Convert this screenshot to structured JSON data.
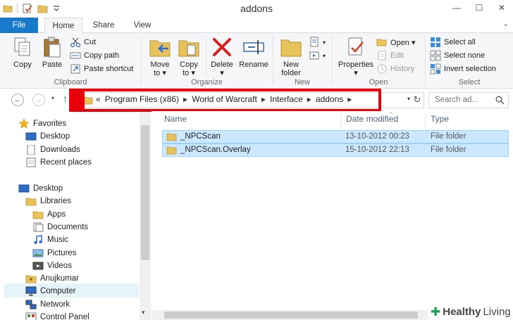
{
  "window": {
    "title": "addons",
    "minimize": "—",
    "maximize": "☐",
    "close": "✕"
  },
  "ribbon_tabs": {
    "file": "File",
    "home": "Home",
    "share": "Share",
    "view": "View",
    "expand": "⌄"
  },
  "ribbon": {
    "clipboard": {
      "label": "Clipboard",
      "copy": "Copy",
      "paste": "Paste",
      "cut": "Cut",
      "copy_path": "Copy path",
      "paste_shortcut": "Paste shortcut"
    },
    "organize": {
      "label": "Organize",
      "move_to_1": "Move",
      "move_to_2": "to ▾",
      "copy_to_1": "Copy",
      "copy_to_2": "to ▾",
      "delete_1": "Delete",
      "delete_2": "▾",
      "rename": "Rename"
    },
    "new": {
      "label": "New",
      "new_folder_1": "New",
      "new_folder_2": "folder"
    },
    "open": {
      "label": "Open",
      "properties_1": "Properties",
      "properties_2": "▾",
      "open": "Open ▾",
      "edit": "Edit",
      "history": "History"
    },
    "select": {
      "label": "Select",
      "select_all": "Select all",
      "select_none": "Select none",
      "invert_selection": "Invert selection"
    }
  },
  "address": {
    "back": "←",
    "forward": "→",
    "recent": "▾",
    "up": "↑",
    "prefix": "«",
    "crumbs": [
      "Program Files (x86)",
      "World of Warcraft",
      "Interface",
      "addons"
    ],
    "separator": "▶",
    "dropdown": "▾",
    "refresh": "↻",
    "search_placeholder": "Search ad..."
  },
  "nav_pane": {
    "favorites": "Favorites",
    "desktop_fav": "Desktop",
    "downloads": "Downloads",
    "recent_places": "Recent places",
    "desktop": "Desktop",
    "libraries": "Libraries",
    "apps": "Apps",
    "documents": "Documents",
    "music": "Music",
    "pictures": "Pictures",
    "videos": "Videos",
    "user": "Anujkumar",
    "computer": "Computer",
    "network": "Network",
    "control_panel": "Control Panel",
    "scroll_down": "▾"
  },
  "file_list": {
    "columns": {
      "name": "Name",
      "date": "Date modified",
      "type": "Type",
      "sort": "^"
    },
    "rows": [
      {
        "name": "_NPCScan",
        "date": "13-10-2012 00:23",
        "type": "File folder"
      },
      {
        "name": "_NPCScan.Overlay",
        "date": "15-10-2012 22:13",
        "type": "File folder"
      }
    ]
  },
  "watermark": {
    "plus": "✚",
    "word1": "Healthy",
    "word2": "Living"
  },
  "colors": {
    "file_tab": "#1979ca",
    "highlight_border": "#e8000b",
    "selection": "#cce8ff",
    "selection_border": "#99d1ff",
    "folder": "#e8c25a"
  }
}
